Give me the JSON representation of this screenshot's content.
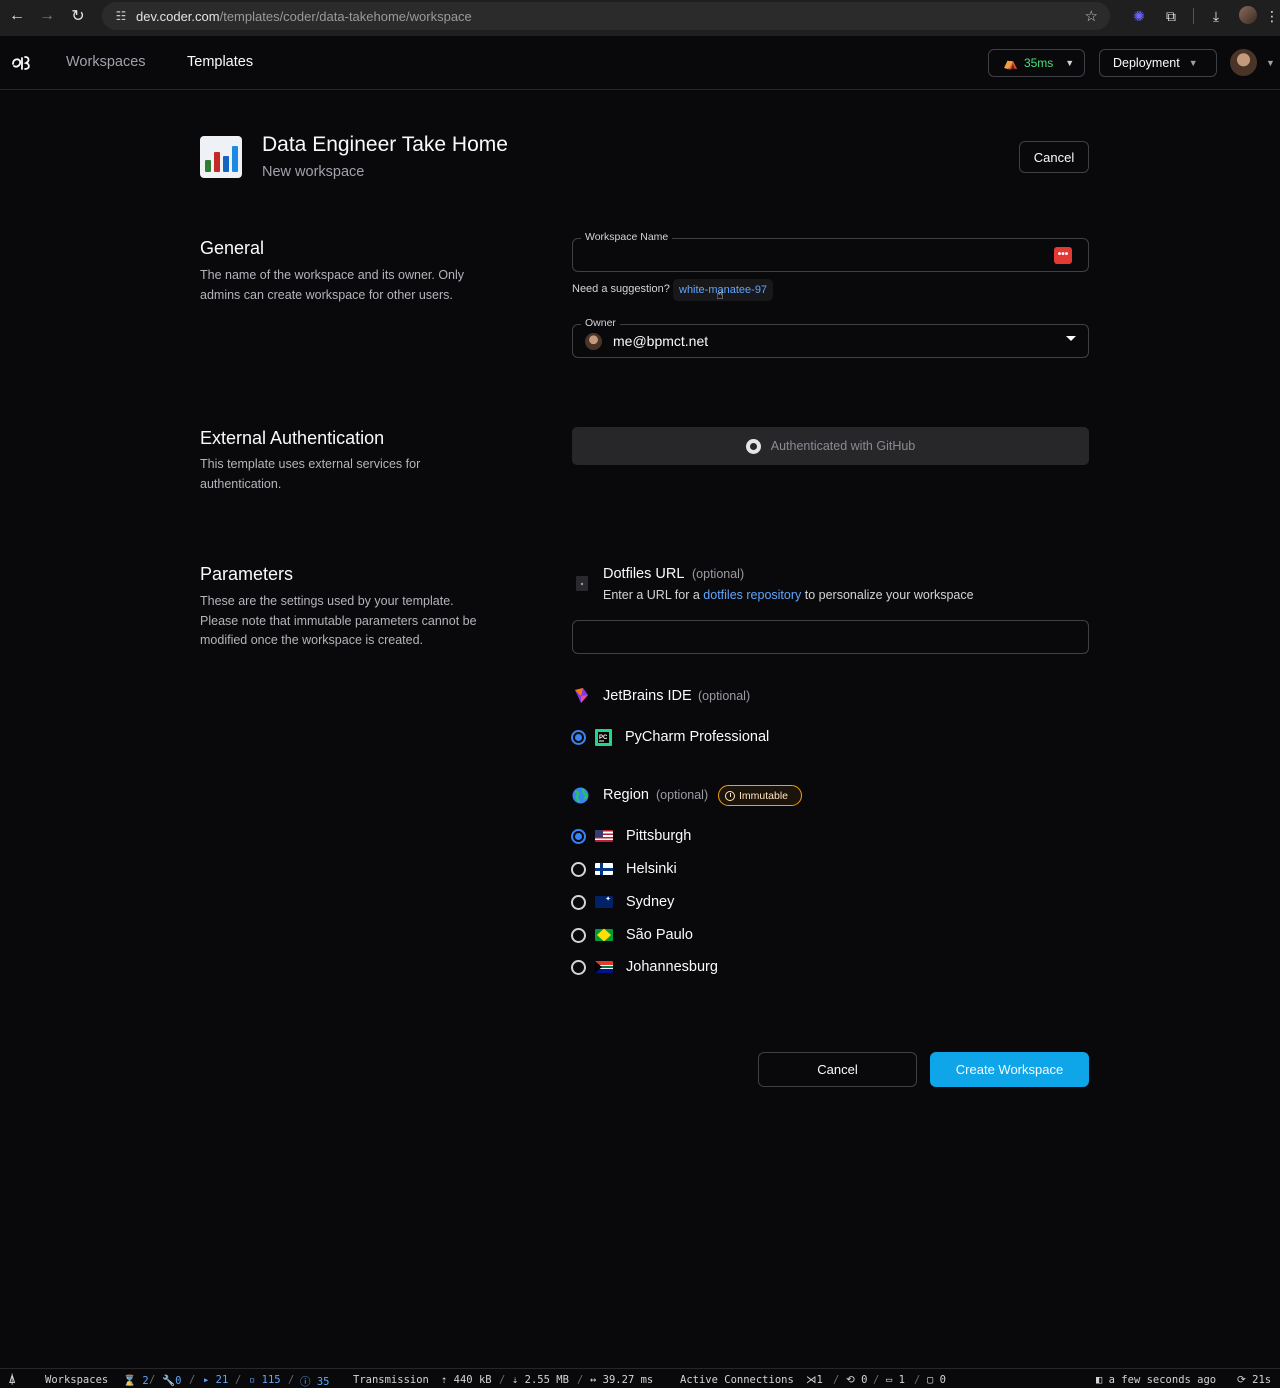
{
  "browser": {
    "url_host": "dev.coder.com",
    "url_path": "/templates/coder/data-takehome/workspace"
  },
  "nav": {
    "workspaces": "Workspaces",
    "templates": "Templates",
    "latency": "35ms",
    "deployment": "Deployment"
  },
  "header": {
    "title": "Data Engineer Take Home",
    "subtitle": "New workspace",
    "cancel": "Cancel"
  },
  "general": {
    "title": "General",
    "description": "The name of the workspace and its owner. Only admins can create workspace for other users.",
    "workspace_name_label": "Workspace Name",
    "workspace_name_value": "",
    "suggestion_prompt": "Need a suggestion?",
    "suggestion": "white-manatee-97",
    "owner_label": "Owner",
    "owner_value": "me@bpmct.net"
  },
  "external_auth": {
    "title": "External Authentication",
    "description": "This template uses external services for authentication.",
    "github_button": "Authenticated with GitHub"
  },
  "parameters": {
    "title": "Parameters",
    "description": "These are the settings used by your template. Please note that immutable parameters cannot be modified once the workspace is created.",
    "dotfiles": {
      "name": "Dotfiles URL",
      "optional": "(optional)",
      "desc_before": "Enter a URL for a",
      "desc_link": "dotfiles repository",
      "desc_after": "to personalize your workspace",
      "value": ""
    },
    "jetbrains": {
      "name": "JetBrains IDE",
      "optional": "(optional)",
      "options": [
        "PyCharm Professional"
      ],
      "selected": "PyCharm Professional"
    },
    "region": {
      "name": "Region",
      "optional": "(optional)",
      "badge": "Immutable",
      "options": [
        "Pittsburgh",
        "Helsinki",
        "Sydney",
        "São Paulo",
        "Johannesburg"
      ],
      "selected": "Pittsburgh"
    }
  },
  "actions": {
    "cancel": "Cancel",
    "create": "Create Workspace"
  },
  "statusbar": {
    "workspaces_label": "Workspaces",
    "pending": "2",
    "building": "0",
    "running": "21",
    "stopped": "115",
    "failed": "35",
    "transmission_label": "Transmission",
    "upload": "440 kB",
    "download": "2.55 MB",
    "latency": "39.27 ms",
    "connections_label": "Active Connections",
    "vscode": "1",
    "ssh": "0",
    "web_terminal": "1",
    "reconnecting_pty": "0",
    "updated": "a few seconds ago",
    "refresh": "21s"
  },
  "colors": {
    "accent": "#0ea5e9",
    "link": "#60a5fa",
    "immutable": "#f59e0b",
    "latency_good": "#4ade80"
  }
}
